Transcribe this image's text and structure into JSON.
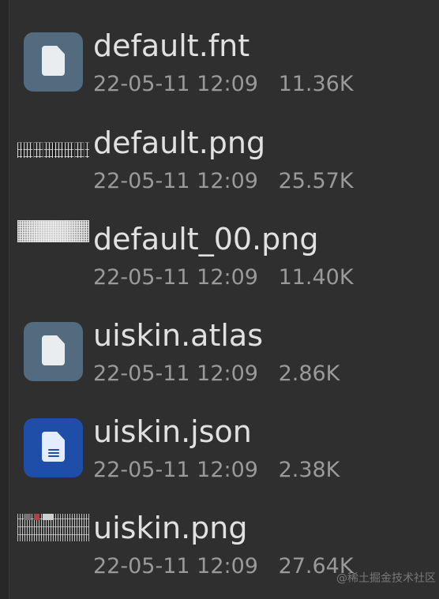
{
  "files": [
    {
      "name": "default.fnt",
      "date": "22-05-11",
      "time": "12:09",
      "size": "11.36K",
      "icon": "file-icon",
      "icon_color": "#536b7f"
    },
    {
      "name": "default.png",
      "date": "22-05-11",
      "time": "12:09",
      "size": "25.57K",
      "icon": "font-image-thumbnail"
    },
    {
      "name": "default_00.png",
      "date": "22-05-11",
      "time": "12:09",
      "size": "11.40K",
      "icon": "noisy-image-thumbnail"
    },
    {
      "name": "uiskin.atlas",
      "date": "22-05-11",
      "time": "12:09",
      "size": "2.86K",
      "icon": "file-icon",
      "icon_color": "#536b7f"
    },
    {
      "name": "uiskin.json",
      "date": "22-05-11",
      "time": "12:09",
      "size": "2.38K",
      "icon": "json-document-icon",
      "icon_color": "#1f4ea8"
    },
    {
      "name": "uiskin.png",
      "date": "22-05-11",
      "time": "12:09",
      "size": "27.64K",
      "icon": "ui-image-thumbnail"
    }
  ],
  "watermark": "@稀土掘金技术社区",
  "colors": {
    "background": "#2f2f2f",
    "primary_text": "#e1e1e1",
    "secondary_text": "#9a9a9a"
  }
}
